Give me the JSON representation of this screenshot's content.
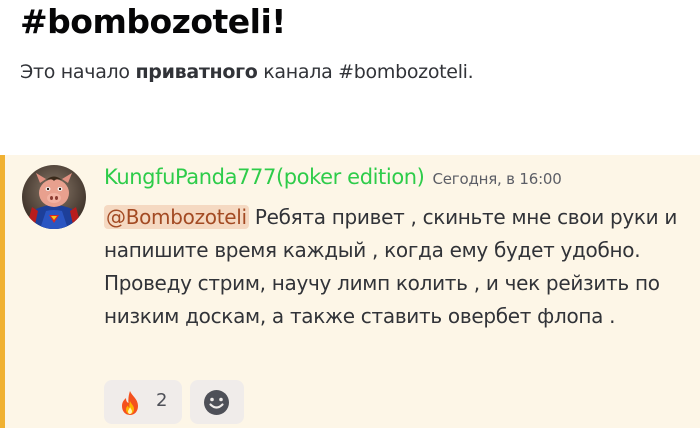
{
  "channel": {
    "title": "#bombozoteli!",
    "desc_prefix": "Это начало ",
    "desc_bold": "приватного",
    "desc_suffix": " канала #bombozoteli."
  },
  "message": {
    "username": "KungfuPanda777(poker edition)",
    "timestamp": "Сегодня, в 16:00",
    "mention": "@Bombozoteli",
    "text": " Ребята привет , скиньте мне свои руки и напишите время каждый , когда ему будет удобно. Проведу стрим, научу лимп колить , и чек рейзить по низким доскам, а также ставить овербет флопа ."
  },
  "reactions": [
    {
      "emoji": "fire-icon",
      "count": "2"
    }
  ],
  "colors": {
    "username": "#2ecc4a",
    "mention_bg": "#f5d9c2",
    "mention_text": "#a34a23",
    "highlight_bg": "#fdf6e7",
    "highlight_bar": "#f0b132"
  }
}
